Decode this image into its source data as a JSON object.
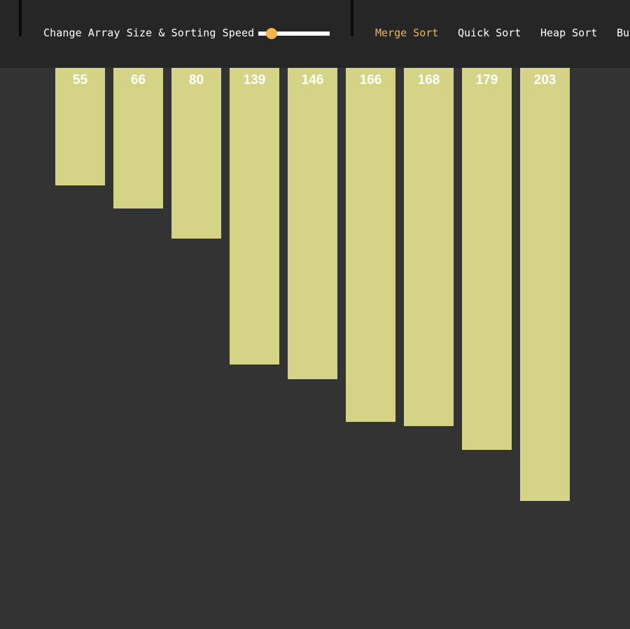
{
  "controls": {
    "label": "Change Array Size & Sorting Speed",
    "slider_value": 0.1
  },
  "algorithms": [
    {
      "label": "Merge Sort",
      "active": true
    },
    {
      "label": "Quick Sort",
      "active": false
    },
    {
      "label": "Heap Sort",
      "active": false
    },
    {
      "label": "Bu",
      "active": false
    }
  ],
  "colors": {
    "accent": "#f6b44a",
    "bar": "#d4d386",
    "background": "#333333",
    "topbar": "#262626"
  },
  "array": {
    "values": [
      "55",
      "66",
      "80",
      "139",
      "146",
      "166",
      "168",
      "179",
      "203"
    ]
  }
}
